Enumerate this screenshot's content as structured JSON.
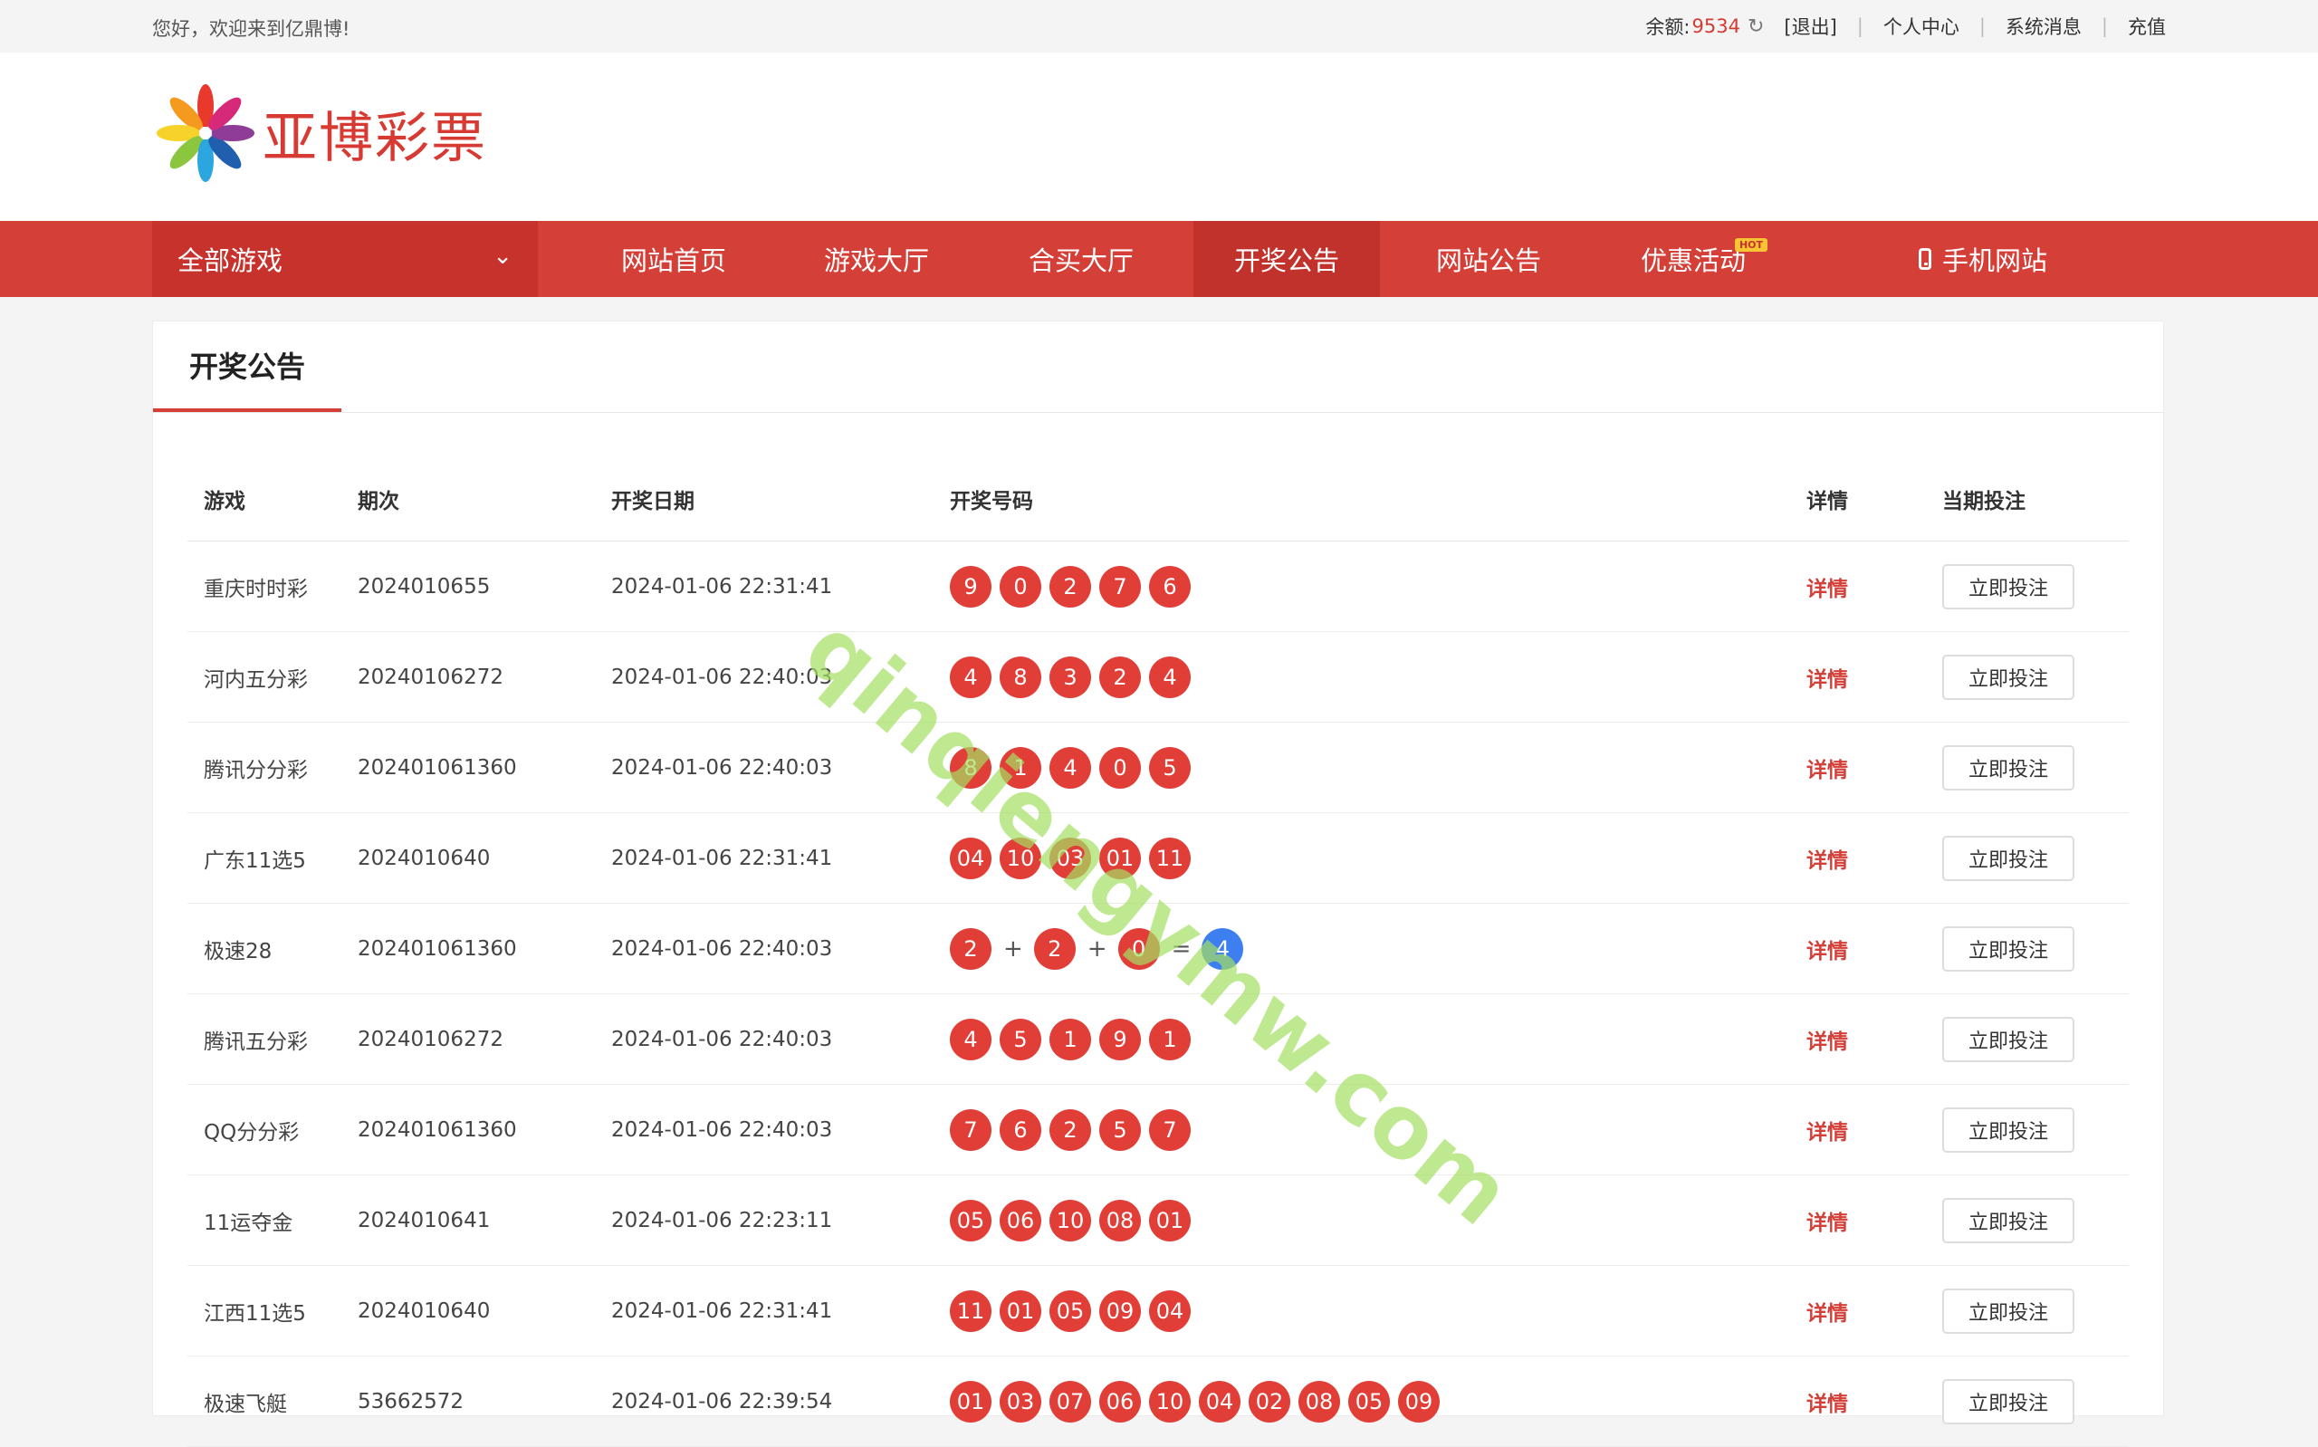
{
  "topbar": {
    "greeting": "您好，欢迎来到亿鼎博!",
    "balance_label": "余额:",
    "balance_value": "9534",
    "logout": "[退出]",
    "personal_center": "个人中心",
    "system_messages": "系统消息",
    "recharge": "充值"
  },
  "logo": {
    "text": "亚博彩票"
  },
  "nav": {
    "all_games": "全部游戏",
    "items": [
      "网站首页",
      "游戏大厅",
      "合买大厅",
      "开奖公告",
      "网站公告",
      "优惠活动",
      "手机网站"
    ],
    "hot_badge": "HOT",
    "active": "开奖公告"
  },
  "panel": {
    "tab": "开奖公告"
  },
  "table": {
    "headers": [
      "游戏",
      "期次",
      "开奖日期",
      "开奖号码",
      "详情",
      "当期投注"
    ],
    "detail_label": "详情",
    "bet_label": "立即投注",
    "rows": [
      {
        "game": "重庆时时彩",
        "issue": "2024010655",
        "date": "2024-01-06 22:31:41",
        "numbers": [
          "9",
          "0",
          "2",
          "7",
          "6"
        ]
      },
      {
        "game": "河内五分彩",
        "issue": "20240106272",
        "date": "2024-01-06 22:40:03",
        "numbers": [
          "4",
          "8",
          "3",
          "2",
          "4"
        ]
      },
      {
        "game": "腾讯分分彩",
        "issue": "202401061360",
        "date": "2024-01-06 22:40:03",
        "numbers": [
          "8",
          "1",
          "4",
          "0",
          "5"
        ]
      },
      {
        "game": "广东11选5",
        "issue": "2024010640",
        "date": "2024-01-06 22:31:41",
        "numbers": [
          "04",
          "10",
          "03",
          "01",
          "11"
        ]
      },
      {
        "game": "极速28",
        "issue": "202401061360",
        "date": "2024-01-06 22:40:03",
        "numbers": [
          "2",
          "2",
          "0"
        ],
        "sum": "4"
      },
      {
        "game": "腾讯五分彩",
        "issue": "20240106272",
        "date": "2024-01-06 22:40:03",
        "numbers": [
          "4",
          "5",
          "1",
          "9",
          "1"
        ]
      },
      {
        "game": "QQ分分彩",
        "issue": "202401061360",
        "date": "2024-01-06 22:40:03",
        "numbers": [
          "7",
          "6",
          "2",
          "5",
          "7"
        ]
      },
      {
        "game": "11运夺金",
        "issue": "2024010641",
        "date": "2024-01-06 22:23:11",
        "numbers": [
          "05",
          "06",
          "10",
          "08",
          "01"
        ]
      },
      {
        "game": "江西11选5",
        "issue": "2024010640",
        "date": "2024-01-06 22:31:41",
        "numbers": [
          "11",
          "01",
          "05",
          "09",
          "04"
        ]
      },
      {
        "game": "极速飞艇",
        "issue": "53662572",
        "date": "2024-01-06 22:39:54",
        "numbers": [
          "01",
          "03",
          "07",
          "06",
          "10",
          "04",
          "02",
          "08",
          "05",
          "09"
        ]
      }
    ]
  },
  "watermark": "qinqiengymw.com",
  "colors": {
    "brand_red": "#d43f38",
    "ball_red": "#e03e37",
    "ball_blue": "#3d7ff0"
  }
}
